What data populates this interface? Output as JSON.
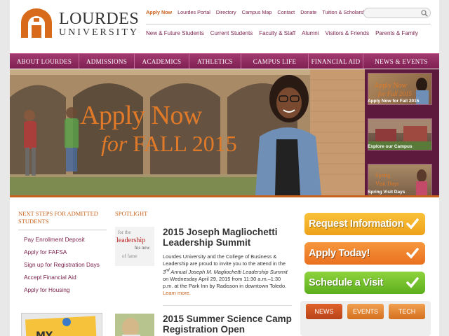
{
  "header": {
    "logo": {
      "name": "LOURDES",
      "sub": "UNIVERSITY"
    },
    "utility_links": [
      "Apply Now",
      "Lourdes Portal",
      "Directory",
      "Campus Map",
      "Contact",
      "Donate",
      "Tuition & Scholarships"
    ],
    "audience_links": [
      "New & Future Students",
      "Current Students",
      "Faculty & Staff",
      "Alumni",
      "Visitors & Friends",
      "Parents & Family"
    ],
    "search": {
      "placeholder": "",
      "icon": "search-icon"
    }
  },
  "main_nav": [
    "ABOUT LOURDES",
    "ADMISSIONS",
    "ACADEMICS",
    "ATHLETICS",
    "CAMPUS LIFE",
    "FINANCIAL AID",
    "NEWS & EVENTS"
  ],
  "hero": {
    "line1": "Apply Now",
    "line2_for": "for",
    "line2_rest": "FALL 2015",
    "thumbnails": [
      {
        "caption": "Apply Now for Fall 2015",
        "overlay": "Apply Now for Fall 2015"
      },
      {
        "caption": "Explore our Campus"
      },
      {
        "caption": "Spring Visit Days",
        "overlay": "Spring Visit Days"
      }
    ]
  },
  "next_steps": {
    "heading": "NEXT STEPS FOR ADMITTED STUDENTS",
    "items": [
      "Pay Enrollment Deposit",
      "Apply for FAFSA",
      "Sign up for Registration Days",
      "Accept Financial Aid",
      "Apply for Housing"
    ]
  },
  "spotlight": {
    "heading": "SPOTLIGHT",
    "articles": [
      {
        "title": "2015 Joseph Magliochetti Leadership Summit",
        "body_1": "Lourdes University and the College of Business & Leadership are proud to invite you to the attend in the ",
        "body_ordinal": "3",
        "body_ordinal_suffix": "rd",
        "body_italic": " Annual Joseph M. Magliochetti Leadership Summit",
        "body_2": " on Wednesday April 29, 2015 from 11:30 a.m.–1:30 p.m. at the Park Inn by Radisson in downtown Toledo. ",
        "more": "Learn more.",
        "image_words": [
          "for the",
          "leadership",
          "his new",
          "of fame"
        ]
      },
      {
        "title": "2015 Summer Science Camp Registration Open"
      }
    ]
  },
  "cta_buttons": [
    {
      "label": "Request Information",
      "color_top": "#f9c23a",
      "color_bottom": "#eea21a"
    },
    {
      "label": "Apply Today!",
      "color_top": "#f7983e",
      "color_bottom": "#e96f1e"
    },
    {
      "label": "Schedule a Visit",
      "color_top": "#8fd33e",
      "color_bottom": "#5cae1c"
    }
  ],
  "tabs": [
    "NEWS",
    "EVENTS",
    "TECH"
  ],
  "colors": {
    "brand_purple": "#7a1f4a",
    "brand_orange": "#c8611c"
  }
}
